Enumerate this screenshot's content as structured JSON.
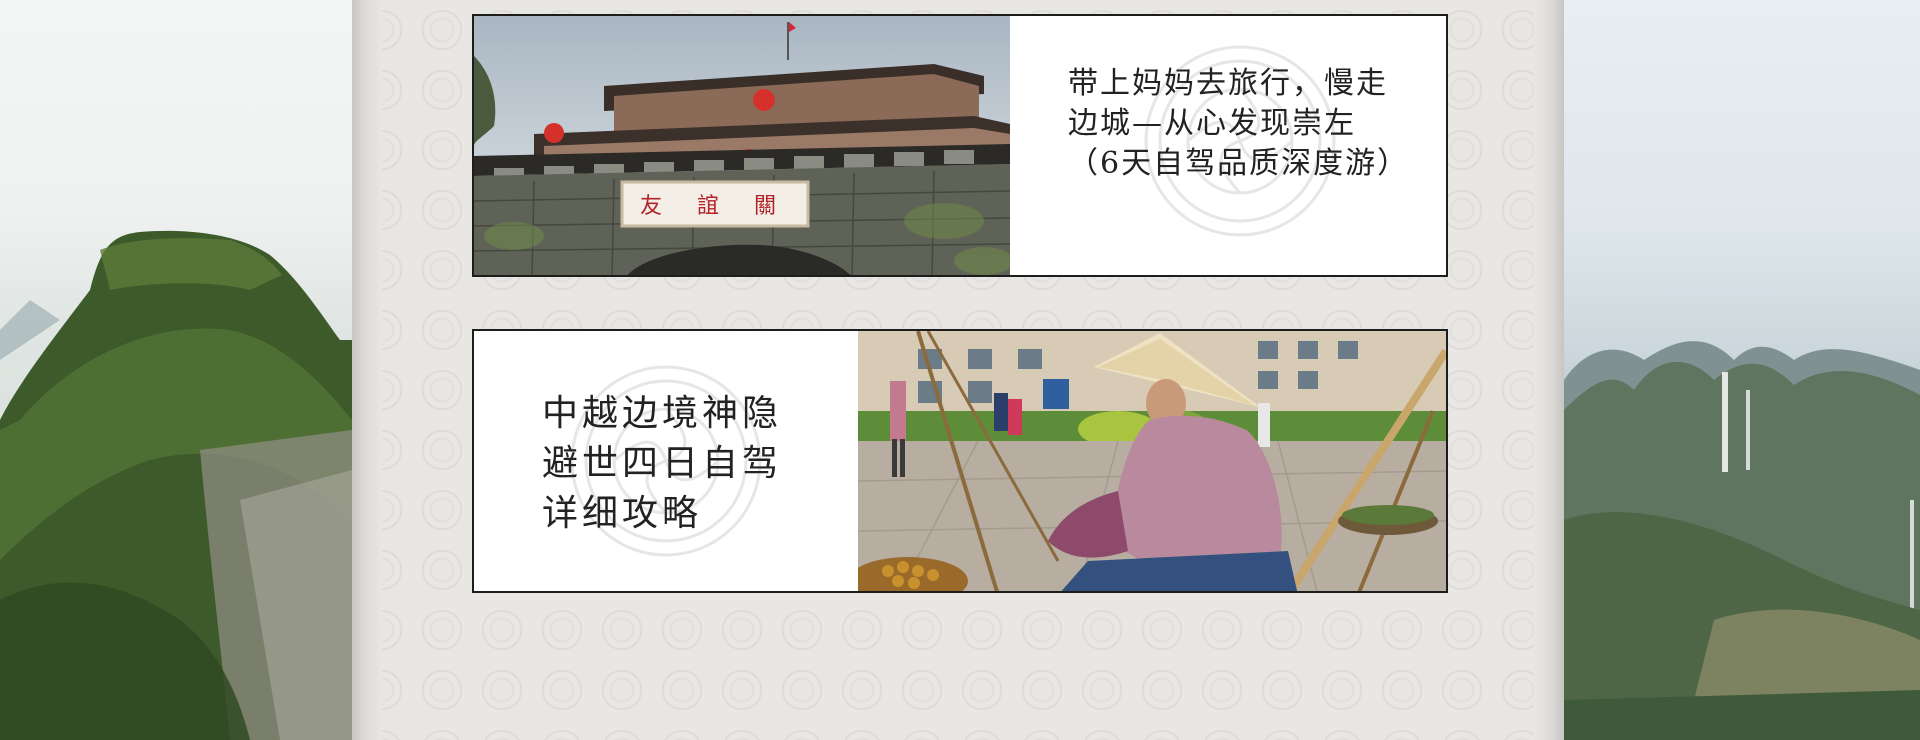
{
  "articles": [
    {
      "title": "带上妈妈去旅行，慢走边城—从心发现崇左（6天自驾品质深度游）",
      "photo_sign_text": "友 誼 關"
    },
    {
      "title": "中越边境神隐避世四日自驾详细攻略"
    }
  ],
  "theme": {
    "border": "#1d1d1d",
    "text": "#222222",
    "paper": "#e9e7e4"
  }
}
